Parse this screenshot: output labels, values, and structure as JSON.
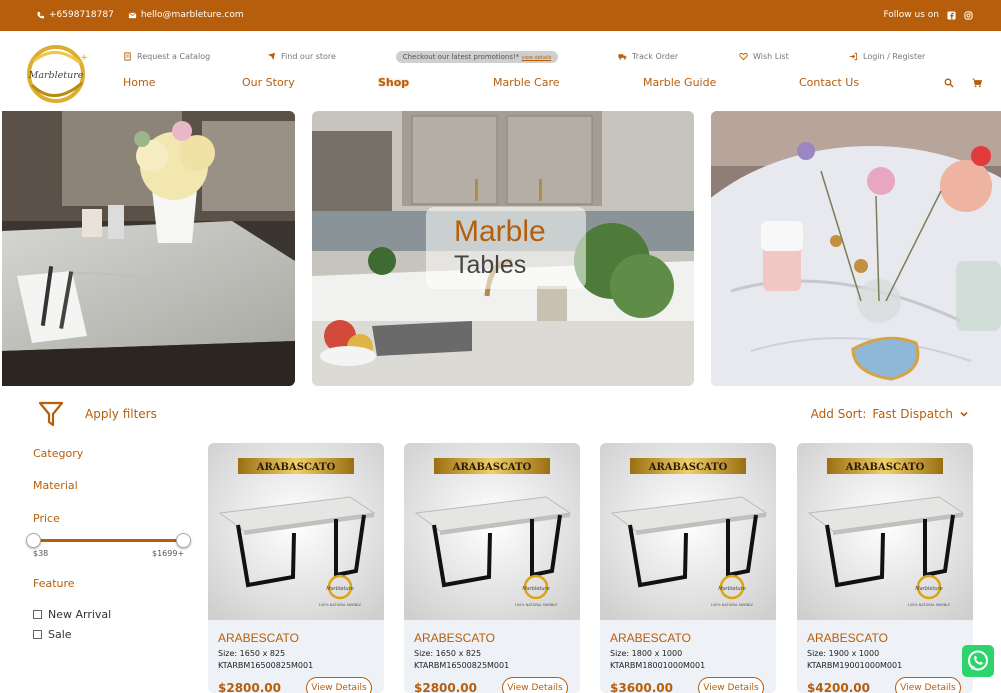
{
  "topbar": {
    "phone": "+6598718787",
    "email": "hello@marbleture.com",
    "follow_label": "Follow us on"
  },
  "header": {
    "logo_text": "Marbleture",
    "utility": {
      "catalog": "Request a Catalog",
      "store": "Find our store",
      "track": "Track Order",
      "wishlist": "Wish List",
      "login": "Login / Register"
    },
    "promo": {
      "text": "Checkout our latest promotions!*",
      "link": "view details"
    },
    "nav": [
      "Home",
      "Our Story",
      "Shop",
      "Marble Care",
      "Marble Guide",
      "Contact Us"
    ],
    "active_nav": "Shop"
  },
  "banner": {
    "title_line1": "Marble",
    "title_line2": "Tables"
  },
  "filters": {
    "apply_label": "Apply filters",
    "sort_label": "Add Sort:",
    "sort_value": "Fast Dispatch"
  },
  "sidebar": {
    "category": "Category",
    "material": "Material",
    "price": "Price",
    "price_min": "$38",
    "price_max": "$1699+",
    "feature": "Feature",
    "features": [
      "New Arrival",
      "Sale"
    ]
  },
  "products": [
    {
      "label": "ARABASCATO",
      "name": "ARABESCATO",
      "size": "Size: 1650 x 825",
      "sku": "KTARBM16500825M001",
      "price": "$2800.00",
      "button": "View Details"
    },
    {
      "label": "ARABASCATO",
      "name": "ARABESCATO",
      "size": "Size: 1650 x 825",
      "sku": "KTARBM16500825M001",
      "price": "$2800.00",
      "button": "View Details"
    },
    {
      "label": "ARABASCATO",
      "name": "ARABESCATO",
      "size": "Size: 1800 x 1000",
      "sku": "KTARBM18001000M001",
      "price": "$3600.00",
      "button": "View Details"
    },
    {
      "label": "ARABASCATO",
      "name": "ARABESCATO",
      "size": "Size: 1900 x 1000",
      "sku": "KTARBM19001000M001",
      "price": "$4200.00",
      "button": "View Details"
    }
  ],
  "product_badge_sub": "100% NATURAL MARBLE",
  "colors": {
    "brand": "#b65e0b",
    "card_bg": "#eef1f6",
    "whatsapp": "#2cd46b"
  }
}
